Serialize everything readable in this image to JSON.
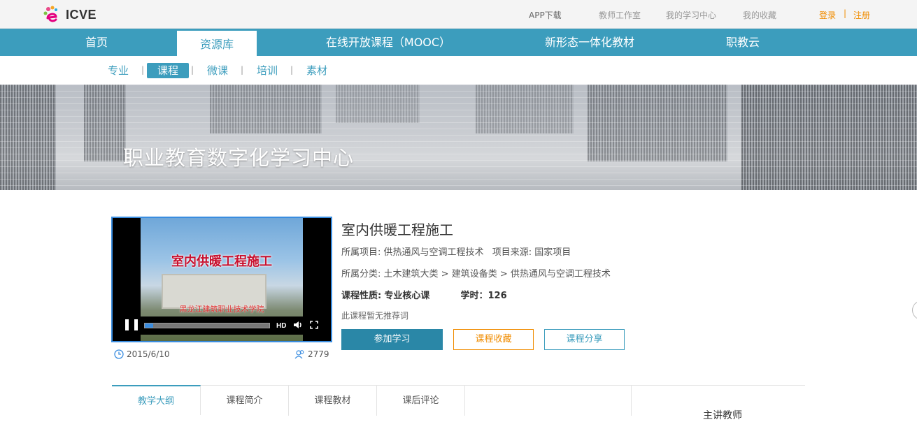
{
  "header": {
    "logo_text": "ICVE",
    "links": {
      "app": "APP下载",
      "teacher": "教师工作室",
      "learning": "我的学习中心",
      "favorites": "我的收藏",
      "login": "登录",
      "separator": "|",
      "register": "注册"
    }
  },
  "nav": {
    "home": "首页",
    "resources": "资源库",
    "mooc": "在线开放课程（MOOC）",
    "textbook": "新形态一体化教材",
    "cloud": "职教云"
  },
  "subnav": {
    "major": "专业",
    "course": "课程",
    "micro": "微课",
    "training": "培训",
    "material": "素材",
    "separator": "|"
  },
  "banner": {
    "title": "职业教育数字化学习中心"
  },
  "video": {
    "title": "室内供暖工程施工",
    "subtitle": "黑龙江建筑职业技术学院",
    "hd_label": "HD",
    "progress": 0.07
  },
  "course": {
    "title": "室内供暖工程施工",
    "project_label": "所属项目:",
    "project_value": "供热通风与空调工程技术",
    "source_label": "项目来源:",
    "source_value": "国家项目",
    "category_label": "所属分类:",
    "category_value": "土木建筑大类 > 建筑设备类 > 供热通风与空调工程技术",
    "nature_label": "课程性质:",
    "nature_value": "专业核心课",
    "hours_label": "学时：",
    "hours_value": "126",
    "recommend_text": "此课程暂无推荐词",
    "date": "2015/6/10",
    "views": "2779"
  },
  "buttons": {
    "join": "参加学习",
    "collect": "课程收藏",
    "share": "课程分享"
  },
  "tabs": [
    "教学大纲",
    "课程简介",
    "课程教材",
    "课后评论"
  ],
  "sidebar": {
    "teacher_title": "主讲教师"
  },
  "colors": {
    "brand": "#3c9dbd",
    "accent_orange": "#f08c00",
    "primary_button": "#2a87a7"
  }
}
